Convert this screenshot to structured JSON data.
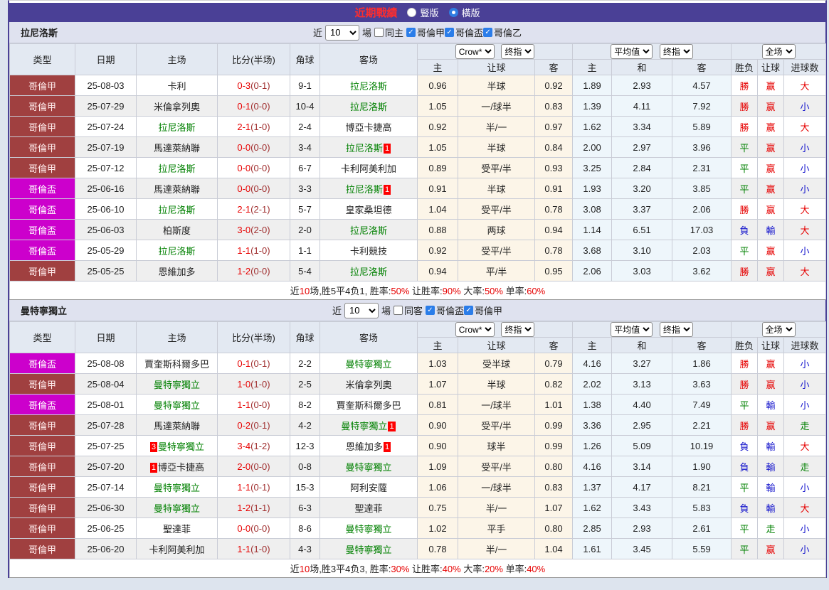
{
  "titlebar": {
    "title": "近期戰績",
    "radio_vertical": "豎版",
    "radio_horizontal": "橫版"
  },
  "controls": {
    "near": "近",
    "games": "場"
  },
  "selects": {
    "count": "10",
    "crow": "Crow*",
    "final": "终指",
    "avg": "平均值",
    "scope": "全场"
  },
  "columns": {
    "type": "类型",
    "date": "日期",
    "home": "主场",
    "score": "比分(半场)",
    "corner": "角球",
    "away": "客场",
    "odds_home": "主",
    "odds_hcap": "让球",
    "odds_away": "客",
    "avg_home": "主",
    "avg_draw": "和",
    "avg_away": "客",
    "wl": "胜负",
    "hcap_res": "让球",
    "goals": "进球数"
  },
  "colors": {
    "titlebar_bg": "#4a4096",
    "league_primary": "#a04040",
    "league_cup": "#cc00cc",
    "focus_team": "#008000",
    "win": "#e60000",
    "draw": "#008000",
    "lose": "#1414cc"
  },
  "t1": {
    "team": "拉尼洛斯",
    "same_label": "同主",
    "leagues": [
      "哥倫甲",
      "哥倫盃",
      "哥倫乙"
    ],
    "rows": [
      {
        "tc": "lga",
        "type": "哥倫甲",
        "date": "25-08-03",
        "home": "卡利",
        "score": "0-3",
        "half": "(0-1)",
        "corner": "9-1",
        "away": "拉尼洛斯",
        "ac": "g",
        "o1": "0.96",
        "oh": "半球",
        "o2": "0.92",
        "a1": "1.89",
        "ax": "2.93",
        "a2": "4.57",
        "wl": "勝",
        "wlc": "r",
        "hr": "赢",
        "hrc": "r",
        "gl": "大",
        "glc": "r"
      },
      {
        "tc": "lga",
        "type": "哥倫甲",
        "date": "25-07-29",
        "home": "米倫拿列奧",
        "score": "0-1",
        "half": "(0-0)",
        "corner": "10-4",
        "away": "拉尼洛斯",
        "ac": "g",
        "o1": "1.05",
        "oh": "一/球半",
        "o2": "0.83",
        "a1": "1.39",
        "ax": "4.11",
        "a2": "7.92",
        "wl": "勝",
        "wlc": "r",
        "hr": "赢",
        "hrc": "r",
        "gl": "小",
        "glc": "b"
      },
      {
        "tc": "lga",
        "type": "哥倫甲",
        "date": "25-07-24",
        "home": "拉尼洛斯",
        "hc": "g",
        "score": "2-1",
        "half": "(1-0)",
        "corner": "2-4",
        "away": "博亞卡捷高",
        "o1": "0.92",
        "oh": "半/一",
        "o2": "0.97",
        "a1": "1.62",
        "ax": "3.34",
        "a2": "5.89",
        "wl": "勝",
        "wlc": "r",
        "hr": "赢",
        "hrc": "r",
        "gl": "大",
        "glc": "r"
      },
      {
        "tc": "lga",
        "type": "哥倫甲",
        "date": "25-07-19",
        "home": "馬達萊納聯",
        "score": "0-0",
        "half": "(0-0)",
        "corner": "3-4",
        "away": "拉尼洛斯",
        "ac": "g",
        "aba": "1",
        "o1": "1.05",
        "oh": "半球",
        "o2": "0.84",
        "a1": "2.00",
        "ax": "2.97",
        "a2": "3.96",
        "wl": "平",
        "wlc": "g",
        "hr": "赢",
        "hrc": "r",
        "gl": "小",
        "glc": "b"
      },
      {
        "tc": "lga",
        "type": "哥倫甲",
        "date": "25-07-12",
        "home": "拉尼洛斯",
        "hc": "g",
        "score": "0-0",
        "half": "(0-0)",
        "corner": "6-7",
        "away": "卡利阿美利加",
        "o1": "0.89",
        "oh": "受平/半",
        "o2": "0.93",
        "a1": "3.25",
        "ax": "2.84",
        "a2": "2.31",
        "wl": "平",
        "wlc": "g",
        "hr": "赢",
        "hrc": "r",
        "gl": "小",
        "glc": "b"
      },
      {
        "tc": "lgc",
        "type": "哥倫盃",
        "date": "25-06-16",
        "home": "馬達萊納聯",
        "score": "0-0",
        "half": "(0-0)",
        "corner": "3-3",
        "away": "拉尼洛斯",
        "ac": "g",
        "aba": "1",
        "o1": "0.91",
        "oh": "半球",
        "o2": "0.91",
        "a1": "1.93",
        "ax": "3.20",
        "a2": "3.85",
        "wl": "平",
        "wlc": "g",
        "hr": "赢",
        "hrc": "r",
        "gl": "小",
        "glc": "b"
      },
      {
        "tc": "lgc",
        "type": "哥倫盃",
        "date": "25-06-10",
        "home": "拉尼洛斯",
        "hc": "g",
        "score": "2-1",
        "half": "(2-1)",
        "corner": "5-7",
        "away": "皇家桑坦德",
        "o1": "1.04",
        "oh": "受平/半",
        "o2": "0.78",
        "a1": "3.08",
        "ax": "3.37",
        "a2": "2.06",
        "wl": "勝",
        "wlc": "r",
        "hr": "赢",
        "hrc": "r",
        "gl": "大",
        "glc": "r"
      },
      {
        "tc": "lgc",
        "type": "哥倫盃",
        "date": "25-06-03",
        "home": "柏斯度",
        "score": "3-0",
        "half": "(2-0)",
        "corner": "2-0",
        "away": "拉尼洛斯",
        "ac": "g",
        "o1": "0.88",
        "oh": "两球",
        "o2": "0.94",
        "a1": "1.14",
        "ax": "6.51",
        "a2": "17.03",
        "wl": "負",
        "wlc": "b",
        "hr": "輸",
        "hrc": "b",
        "gl": "大",
        "glc": "r"
      },
      {
        "tc": "lgc",
        "type": "哥倫盃",
        "date": "25-05-29",
        "home": "拉尼洛斯",
        "hc": "g",
        "score": "1-1",
        "half": "(1-0)",
        "corner": "1-1",
        "away": "卡利競技",
        "o1": "0.92",
        "oh": "受平/半",
        "o2": "0.78",
        "a1": "3.68",
        "ax": "3.10",
        "a2": "2.03",
        "wl": "平",
        "wlc": "g",
        "hr": "赢",
        "hrc": "r",
        "gl": "小",
        "glc": "b"
      },
      {
        "tc": "lga",
        "type": "哥倫甲",
        "date": "25-05-25",
        "home": "恩維加多",
        "score": "1-2",
        "half": "(0-0)",
        "corner": "5-4",
        "away": "拉尼洛斯",
        "ac": "g",
        "o1": "0.94",
        "oh": "平/半",
        "o2": "0.95",
        "a1": "2.06",
        "ax": "3.03",
        "a2": "3.62",
        "wl": "勝",
        "wlc": "r",
        "hr": "赢",
        "hrc": "r",
        "gl": "大",
        "glc": "r"
      }
    ],
    "summary": [
      {
        "t": "近",
        "c": "k"
      },
      {
        "t": "10",
        "c": "r"
      },
      {
        "t": "场,胜5平4负1, 胜率:",
        "c": "k"
      },
      {
        "t": "50%",
        "c": "r"
      },
      {
        "t": " 让胜率:",
        "c": "k"
      },
      {
        "t": "90%",
        "c": "r"
      },
      {
        "t": " 大率:",
        "c": "k"
      },
      {
        "t": "50%",
        "c": "r"
      },
      {
        "t": " 单率:",
        "c": "k"
      },
      {
        "t": "60%",
        "c": "r"
      }
    ]
  },
  "t2": {
    "team": "曼特寧獨立",
    "same_label": "同客",
    "leagues": [
      "哥倫盃",
      "哥倫甲"
    ],
    "rows": [
      {
        "tc": "lgc",
        "type": "哥倫盃",
        "date": "25-08-08",
        "home": "賈奎斯科爾多巴",
        "score": "0-1",
        "half": "(0-1)",
        "corner": "2-2",
        "away": "曼特寧獨立",
        "ac": "g",
        "o1": "1.03",
        "oh": "受半球",
        "o2": "0.79",
        "a1": "4.16",
        "ax": "3.27",
        "a2": "1.86",
        "wl": "勝",
        "wlc": "r",
        "hr": "赢",
        "hrc": "r",
        "gl": "小",
        "glc": "b"
      },
      {
        "tc": "lga",
        "type": "哥倫甲",
        "date": "25-08-04",
        "home": "曼特寧獨立",
        "hc": "g",
        "score": "1-0",
        "half": "(1-0)",
        "corner": "2-5",
        "away": "米倫拿列奧",
        "o1": "1.07",
        "oh": "半球",
        "o2": "0.82",
        "a1": "2.02",
        "ax": "3.13",
        "a2": "3.63",
        "wl": "勝",
        "wlc": "r",
        "hr": "赢",
        "hrc": "r",
        "gl": "小",
        "glc": "b"
      },
      {
        "tc": "lgc",
        "type": "哥倫盃",
        "date": "25-08-01",
        "home": "曼特寧獨立",
        "hc": "g",
        "score": "1-1",
        "half": "(0-0)",
        "corner": "8-2",
        "away": "賈奎斯科爾多巴",
        "o1": "0.81",
        "oh": "一/球半",
        "o2": "1.01",
        "a1": "1.38",
        "ax": "4.40",
        "a2": "7.49",
        "wl": "平",
        "wlc": "g",
        "hr": "輸",
        "hrc": "b",
        "gl": "小",
        "glc": "b"
      },
      {
        "tc": "lga",
        "type": "哥倫甲",
        "date": "25-07-28",
        "home": "馬達萊納聯",
        "score": "0-2",
        "half": "(0-1)",
        "corner": "4-2",
        "away": "曼特寧獨立",
        "ac": "g",
        "aba": "1",
        "o1": "0.90",
        "oh": "受平/半",
        "o2": "0.99",
        "a1": "3.36",
        "ax": "2.95",
        "a2": "2.21",
        "wl": "勝",
        "wlc": "r",
        "hr": "赢",
        "hrc": "r",
        "gl": "走",
        "glc": "g"
      },
      {
        "tc": "lga",
        "type": "哥倫甲",
        "date": "25-07-25",
        "hbb": "3",
        "home": "曼特寧獨立",
        "hc": "g",
        "score": "3-4",
        "half": "(1-2)",
        "corner": "12-3",
        "away": "恩維加多",
        "aba": "1",
        "o1": "0.90",
        "oh": "球半",
        "o2": "0.99",
        "a1": "1.26",
        "ax": "5.09",
        "a2": "10.19",
        "wl": "負",
        "wlc": "b",
        "hr": "輸",
        "hrc": "b",
        "gl": "大",
        "glc": "r"
      },
      {
        "tc": "lga",
        "type": "哥倫甲",
        "date": "25-07-20",
        "hbb": "1",
        "home": "博亞卡捷高",
        "score": "2-0",
        "half": "(0-0)",
        "corner": "0-8",
        "away": "曼特寧獨立",
        "ac": "g",
        "o1": "1.09",
        "oh": "受平/半",
        "o2": "0.80",
        "a1": "4.16",
        "ax": "3.14",
        "a2": "1.90",
        "wl": "負",
        "wlc": "b",
        "hr": "輸",
        "hrc": "b",
        "gl": "走",
        "glc": "g"
      },
      {
        "tc": "lga",
        "type": "哥倫甲",
        "date": "25-07-14",
        "home": "曼特寧獨立",
        "hc": "g",
        "score": "1-1",
        "half": "(0-1)",
        "corner": "15-3",
        "away": "阿利安薩",
        "o1": "1.06",
        "oh": "一/球半",
        "o2": "0.83",
        "a1": "1.37",
        "ax": "4.17",
        "a2": "8.21",
        "wl": "平",
        "wlc": "g",
        "hr": "輸",
        "hrc": "b",
        "gl": "小",
        "glc": "b"
      },
      {
        "tc": "lga",
        "type": "哥倫甲",
        "date": "25-06-30",
        "home": "曼特寧獨立",
        "hc": "g",
        "score": "1-2",
        "half": "(1-1)",
        "corner": "6-3",
        "away": "聖達菲",
        "o1": "0.75",
        "oh": "半/一",
        "o2": "1.07",
        "a1": "1.62",
        "ax": "3.43",
        "a2": "5.83",
        "wl": "負",
        "wlc": "b",
        "hr": "輸",
        "hrc": "b",
        "gl": "大",
        "glc": "r"
      },
      {
        "tc": "lga",
        "type": "哥倫甲",
        "date": "25-06-25",
        "home": "聖達菲",
        "score": "0-0",
        "half": "(0-0)",
        "corner": "8-6",
        "away": "曼特寧獨立",
        "ac": "g",
        "o1": "1.02",
        "oh": "平手",
        "o2": "0.80",
        "a1": "2.85",
        "ax": "2.93",
        "a2": "2.61",
        "wl": "平",
        "wlc": "g",
        "hr": "走",
        "hrc": "g",
        "gl": "小",
        "glc": "b"
      },
      {
        "tc": "lga",
        "type": "哥倫甲",
        "date": "25-06-20",
        "home": "卡利阿美利加",
        "score": "1-1",
        "half": "(1-0)",
        "corner": "4-3",
        "away": "曼特寧獨立",
        "ac": "g",
        "o1": "0.78",
        "oh": "半/一",
        "o2": "1.04",
        "a1": "1.61",
        "ax": "3.45",
        "a2": "5.59",
        "wl": "平",
        "wlc": "g",
        "hr": "赢",
        "hrc": "r",
        "gl": "小",
        "glc": "b"
      }
    ],
    "summary": [
      {
        "t": "近",
        "c": "k"
      },
      {
        "t": "10",
        "c": "r"
      },
      {
        "t": "场,胜3平4负3, 胜率:",
        "c": "k"
      },
      {
        "t": "30%",
        "c": "r"
      },
      {
        "t": " 让胜率:",
        "c": "k"
      },
      {
        "t": "40%",
        "c": "r"
      },
      {
        "t": " 大率:",
        "c": "k"
      },
      {
        "t": "20%",
        "c": "r"
      },
      {
        "t": " 单率:",
        "c": "k"
      },
      {
        "t": "40%",
        "c": "r"
      }
    ]
  }
}
